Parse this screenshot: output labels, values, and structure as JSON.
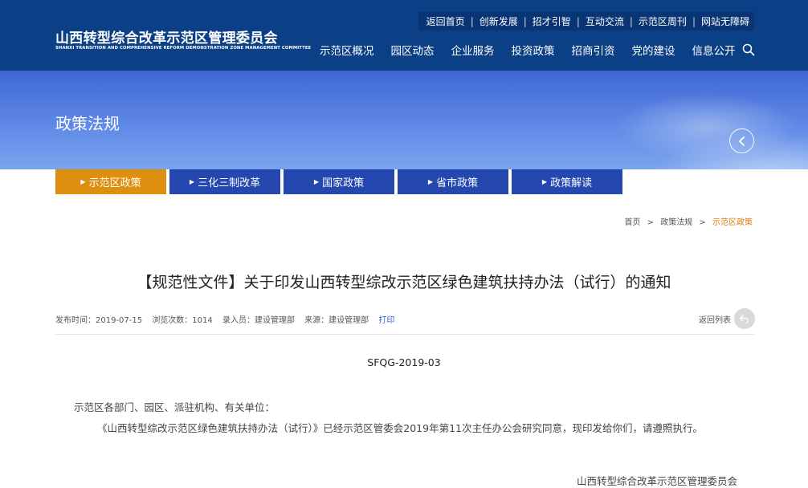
{
  "header": {
    "logo_cn": "山西转型综合改革示范区管理委员会",
    "logo_en": "SHANXI TRANSITION AND COMPREHENSIVE REFORM DEMONSTRATION ZONE MANAGEMENT COMMITTEE",
    "top_links": [
      "返回首页",
      "创新发展",
      "招才引智",
      "互动交流",
      "示范区周刊",
      "网站无障碍"
    ],
    "nav": [
      "示范区概况",
      "园区动态",
      "企业服务",
      "投资政策",
      "招商引资",
      "党的建设",
      "信息公开"
    ],
    "search_icon": "search-icon"
  },
  "banner": {
    "title": "政策法规",
    "arrow_icon": "chevron-left-icon"
  },
  "subtabs": [
    "示范区政策",
    "三化三制改革",
    "国家政策",
    "省市政策",
    "政策解读"
  ],
  "subtabs_active_index": 0,
  "breadcrumb": {
    "home": "首页",
    "section": "政策法规",
    "current": "示范区政策",
    "separator": ">"
  },
  "article": {
    "title": "【规范性文件】关于印发山西转型综改示范区绿色建筑扶持办法（试行）的通知",
    "meta": {
      "publish_time": "发布时间：2019-07-15",
      "views": "浏览次数：1014",
      "entered_by": "录入员：建设管理部",
      "source": "来源：建设管理部",
      "print": "打印"
    },
    "back_list": "返回列表",
    "doc_no": "SFQG-2019-03",
    "para1": "示范区各部门、园区、派驻机构、有关单位：",
    "para2": "《山西转型综改示范区绿色建筑扶持办法（试行）》已经示范区管委会2019年第11次主任办公会研究同意，现印发给你们，请遵照执行。",
    "signature": "山西转型综合改革示范区管理委员会"
  },
  "colors": {
    "header_bg": "#0b3f86",
    "tab_blue": "#2447b0",
    "tab_active": "#df8f0f",
    "breadcrumb_current": "#e07b0c",
    "print_link": "#2b5fc4"
  }
}
